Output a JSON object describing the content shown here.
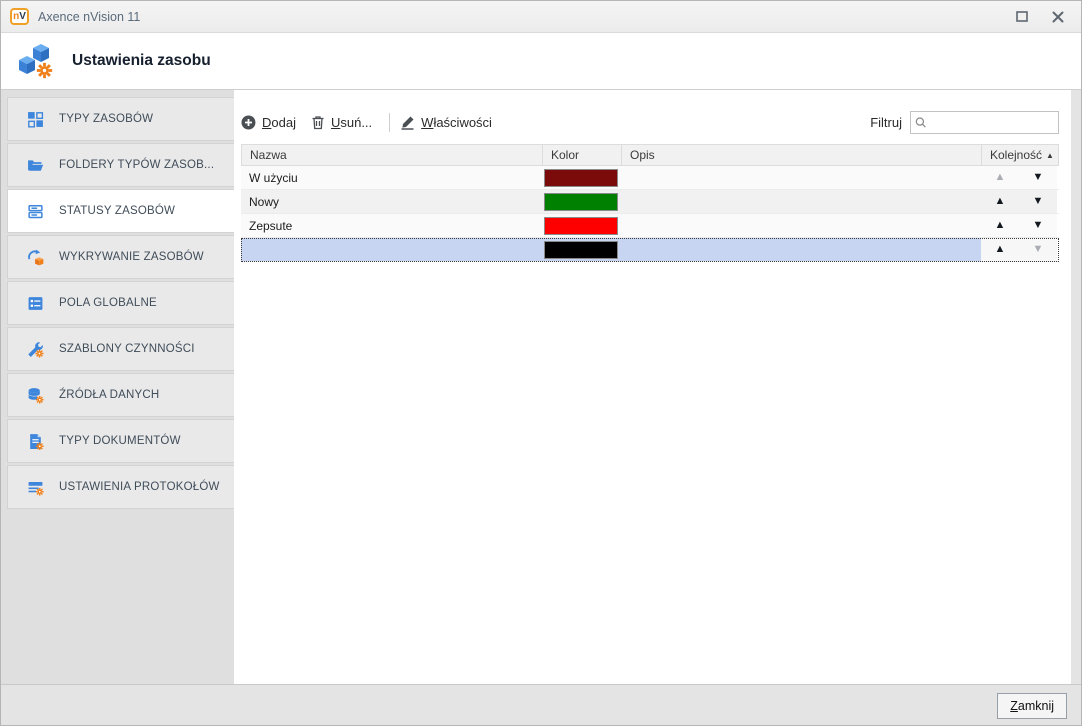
{
  "window": {
    "title": "Axence nVision 11",
    "logo_n": "n",
    "logo_v": "V"
  },
  "header": {
    "title": "Ustawienia zasobu"
  },
  "sidebar": {
    "items": [
      {
        "label": "TYPY ZASOBÓW",
        "icon": "grid-icon",
        "selected": false
      },
      {
        "label": "FOLDERY TYPÓW ZASOB...",
        "icon": "folder-icon",
        "selected": false
      },
      {
        "label": "STATUSY ZASOBÓW",
        "icon": "status-list-icon",
        "selected": true
      },
      {
        "label": "WYKRYWANIE ZASOBÓW",
        "icon": "discovery-icon",
        "selected": false
      },
      {
        "label": "POLA GLOBALNE",
        "icon": "global-fields-icon",
        "selected": false
      },
      {
        "label": "SZABLONY CZYNNOŚCI",
        "icon": "wrench-gear-icon",
        "selected": false
      },
      {
        "label": "ŹRÓDŁA DANYCH",
        "icon": "database-gear-icon",
        "selected": false
      },
      {
        "label": "TYPY DOKUMENTÓW",
        "icon": "document-gear-icon",
        "selected": false
      },
      {
        "label": "USTAWIENIA PROTOKOŁÓW",
        "icon": "protocol-gear-icon",
        "selected": false
      }
    ]
  },
  "toolbar": {
    "add_label": "Dodaj",
    "remove_label": "Usuń...",
    "properties_label": "Właściwości",
    "filter_label": "Filtruj",
    "filter_value": ""
  },
  "table": {
    "columns": [
      "Nazwa",
      "Kolor",
      "Opis",
      "Kolejność"
    ],
    "sort": {
      "column": "Kolejność",
      "direction": "asc"
    },
    "rows": [
      {
        "name": "W użyciu",
        "color": "#7b0b0b",
        "description": "",
        "up_enabled": false,
        "down_enabled": true,
        "selected": false
      },
      {
        "name": "Nowy",
        "color": "#008000",
        "description": "",
        "up_enabled": true,
        "down_enabled": true,
        "selected": false
      },
      {
        "name": "Zepsute",
        "color": "#ff0000",
        "description": "",
        "up_enabled": true,
        "down_enabled": true,
        "selected": false
      },
      {
        "name": "",
        "color": "#000000",
        "description": "",
        "up_enabled": true,
        "down_enabled": false,
        "selected": true
      }
    ]
  },
  "footer": {
    "close_label": "Zamknij"
  },
  "colors": {
    "accent_blue": "#3d86dc",
    "accent_orange": "#f08019",
    "selected_row": "#c7d5f2",
    "header_text": "#16202e"
  }
}
